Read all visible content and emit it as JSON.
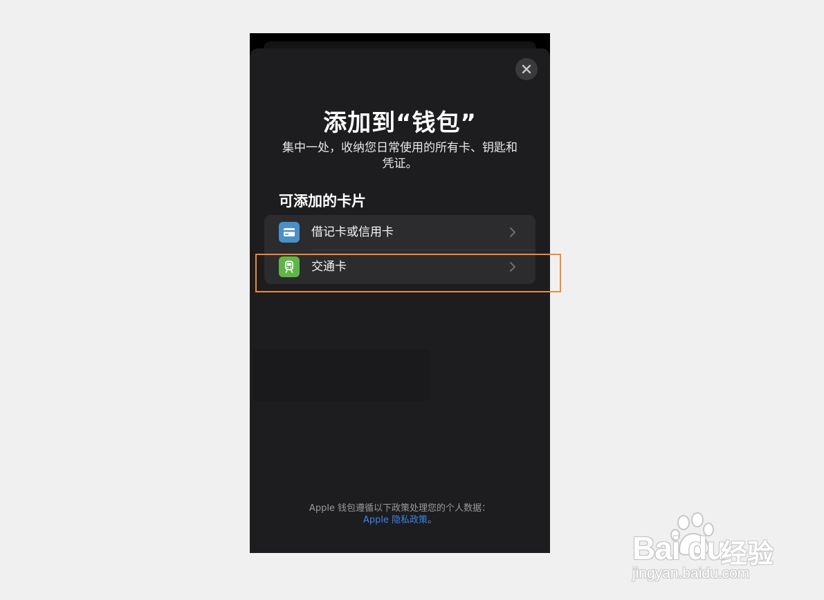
{
  "sheet": {
    "title": "添加到“钱包”",
    "subtitle": "集中一处，收纳您日常使用的所有卡、钥匙和凭证。",
    "section_title": "可添加的卡片",
    "items": [
      {
        "label": "借记卡或信用卡",
        "icon": "credit-card-icon",
        "icon_color": "#4a90c8"
      },
      {
        "label": "交通卡",
        "icon": "train-icon",
        "icon_color": "#5fb548"
      }
    ],
    "footer_text": "Apple 钱包遵循以下政策处理您的个人数据：",
    "footer_link": "Apple 隐私政策",
    "footer_link_suffix": "。"
  },
  "watermark": {
    "brand": "Bai du",
    "brand_cn": "经验",
    "url": "jingyan.baidu.com"
  },
  "colors": {
    "highlight": "#f08a3c",
    "link": "#3a84e8"
  }
}
